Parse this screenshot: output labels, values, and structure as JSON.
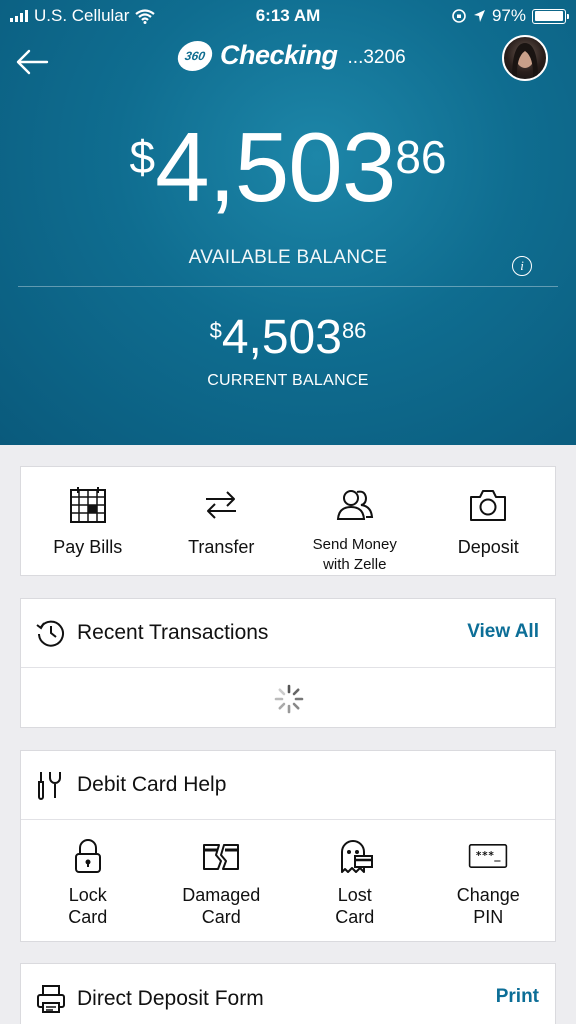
{
  "status_bar": {
    "carrier": "U.S. Cellular",
    "time": "6:13 AM",
    "battery": "97%"
  },
  "header": {
    "brand_badge": "360",
    "brand_name": "Checking",
    "account_suffix": "...3206"
  },
  "balance": {
    "available": {
      "currency": "$",
      "whole": "4,503",
      "cents": "86",
      "label": "AVAILABLE BALANCE"
    },
    "current": {
      "currency": "$",
      "whole": "4,503",
      "cents": "86",
      "label": "CURRENT BALANCE"
    }
  },
  "quick_actions": [
    {
      "label": "Pay Bills",
      "icon": "calendar-icon"
    },
    {
      "label": "Transfer",
      "icon": "transfer-arrows-icon"
    },
    {
      "label_line1": "Send Money",
      "label_line2": "with Zelle",
      "icon": "people-icon"
    },
    {
      "label": "Deposit",
      "icon": "camera-icon"
    }
  ],
  "recent_transactions": {
    "title": "Recent Transactions",
    "link": "View All",
    "loading": true
  },
  "debit_card_help": {
    "title": "Debit Card Help",
    "items": [
      {
        "line1": "Lock",
        "line2": "Card",
        "icon": "lock-icon"
      },
      {
        "line1": "Damaged",
        "line2": "Card",
        "icon": "damaged-card-icon"
      },
      {
        "line1": "Lost",
        "line2": "Card",
        "icon": "ghost-card-icon"
      },
      {
        "line1": "Change",
        "line2": "PIN",
        "icon": "pin-card-icon",
        "pin_mask": "***_"
      }
    ]
  },
  "direct_deposit": {
    "title": "Direct Deposit Form",
    "link": "Print"
  },
  "colors": {
    "hero": "#0f6d90",
    "link": "#0c6e97",
    "background": "#ededf0"
  }
}
